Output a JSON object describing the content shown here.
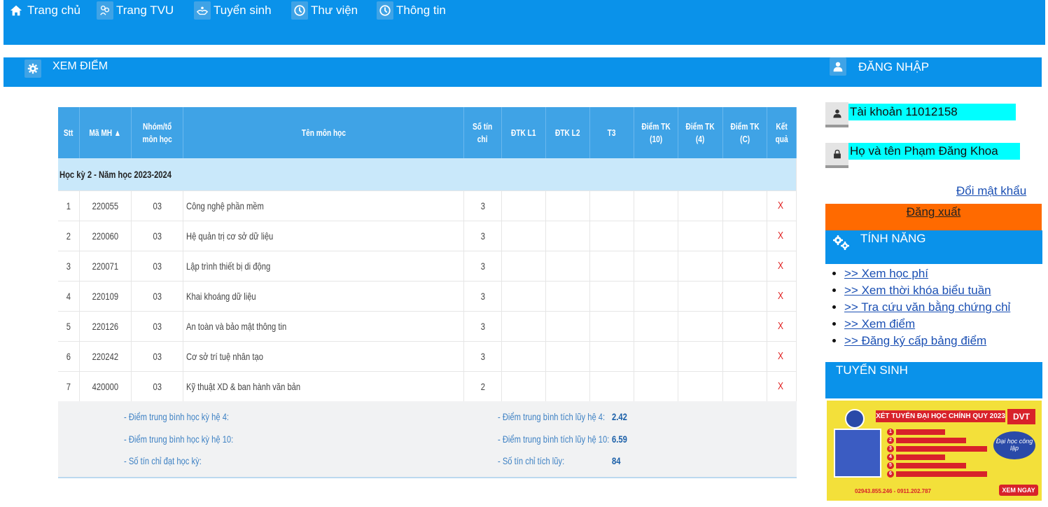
{
  "nav": [
    {
      "label": "Trang chủ",
      "icon": "home-icon"
    },
    {
      "label": "Trang TVU",
      "icon": "people-icon"
    },
    {
      "label": "Tuyển sinh",
      "icon": "hands-icon"
    },
    {
      "label": "Thư viện",
      "icon": "clock-icon"
    },
    {
      "label": "Thông tin",
      "icon": "clock-icon"
    }
  ],
  "main_header": {
    "title": "XEM ĐIỂM",
    "icon": "gear-icon"
  },
  "login_header": {
    "title": "ĐĂNG NHẬP",
    "icon": "user-icon"
  },
  "table": {
    "headers": [
      "Stt",
      "Mã MH ▲",
      "Nhóm/tổ môn học",
      "Tên môn học",
      "Số tín chỉ",
      "ĐTK L1",
      "ĐTK L2",
      "T3",
      "Điểm TK (10)",
      "Điểm TK (4)",
      "Điểm TK (C)",
      "Kết quả"
    ],
    "semester": "Học kỳ 2 - Năm học 2023-2024",
    "rows": [
      {
        "stt": "1",
        "ma": "220055",
        "nhom": "03",
        "ten": "Công nghệ phần mềm",
        "tc": "3",
        "kq": "X"
      },
      {
        "stt": "2",
        "ma": "220060",
        "nhom": "03",
        "ten": "Hệ quản trị cơ sở dữ liệu",
        "tc": "3",
        "kq": "X"
      },
      {
        "stt": "3",
        "ma": "220071",
        "nhom": "03",
        "ten": "Lập trình thiết bị di động",
        "tc": "3",
        "kq": "X"
      },
      {
        "stt": "4",
        "ma": "220109",
        "nhom": "03",
        "ten": "Khai khoáng dữ liệu",
        "tc": "3",
        "kq": "X"
      },
      {
        "stt": "5",
        "ma": "220126",
        "nhom": "03",
        "ten": "An toàn và bảo mật thông tin",
        "tc": "3",
        "kq": "X"
      },
      {
        "stt": "6",
        "ma": "220242",
        "nhom": "03",
        "ten": "Cơ sở trí tuệ nhân tạo",
        "tc": "3",
        "kq": "X"
      },
      {
        "stt": "7",
        "ma": "420000",
        "nhom": "03",
        "ten": "Kỹ thuật XD & ban hành văn bản",
        "tc": "2",
        "kq": "X"
      }
    ]
  },
  "summary": {
    "hk4_label": "- Điểm trung bình học kỳ hệ 4:",
    "hk10_label": "- Điểm trung bình học kỳ hệ 10:",
    "tc_hk_label": "- Số tín chỉ đạt học kỳ:",
    "tl4_label": "- Điểm trung bình tích lũy hệ 4:",
    "tl4_value": "2.42",
    "tl10_label": "- Điểm trung bình tích lũy hệ 10:",
    "tl10_value": "6.59",
    "tc_tl_label": "- Số tín chỉ tích lũy:",
    "tc_tl_value": "84"
  },
  "account": {
    "label": "Tài khoản 11012158",
    "icon": "user-icon"
  },
  "fullname": {
    "label": "Họ và tên Phạm Đăng Khoa",
    "icon": "lock-icon"
  },
  "change_password": "Đổi mật khẩu",
  "logout": "Đăng xuất",
  "features_header": {
    "title": "TÍNH NĂNG",
    "icon": "gears-icon"
  },
  "features": [
    ">> Xem học phí",
    ">> Xem thời khóa biểu tuần",
    ">> Tra cứu văn bằng chứng chỉ",
    ">> Xem điểm",
    ">> Đăng ký cấp bảng điểm"
  ],
  "admission_header": {
    "title": "TUYỂN SINH"
  },
  "banner": {
    "title": "XÉT TUYỂN ĐẠI HỌC CHÍNH QUY 2023",
    "brand": "DVT",
    "slogan": "Đại học công lập",
    "items": [
      "1",
      "2",
      "3",
      "4",
      "5",
      "6"
    ],
    "phone": "02943.855.246 - 0911.202.787",
    "button": "XEM NGAY"
  }
}
